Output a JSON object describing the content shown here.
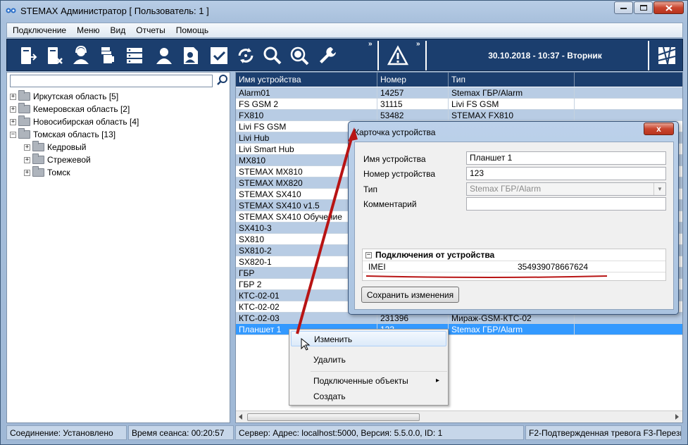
{
  "window": {
    "title": "STEMAX Администратор [ Пользователь: 1 ]"
  },
  "menu": [
    "Подключение",
    "Меню",
    "Вид",
    "Отчеты",
    "Помощь"
  ],
  "toolbar": {
    "icons": [
      "device-in-icon",
      "device-remove-icon",
      "operator-icon",
      "hand-icon",
      "server-icon",
      "user-icon",
      "user-card-icon",
      "check-icon",
      "refresh-icon",
      "search-icon",
      "zoom-in-icon",
      "wrench-icon"
    ],
    "chevron": "»",
    "datetime": "30.10.2018 - 10:37 - Вторник"
  },
  "tree": [
    {
      "label": "Иркутская область [5]",
      "level": 0
    },
    {
      "label": "Кемеровская область [2]",
      "level": 0
    },
    {
      "label": "Новосибирская область [4]",
      "level": 0
    },
    {
      "label": "Томская область [13]",
      "level": 0
    },
    {
      "label": "Кедровый",
      "level": 1
    },
    {
      "label": "Стрежевой",
      "level": 1
    },
    {
      "label": "Томск",
      "level": 1
    }
  ],
  "grid": {
    "columns": [
      "Имя устройства",
      "Номер",
      "Тип"
    ],
    "rows": [
      [
        "Alarm01",
        "14257",
        "Stemax ГБР/Alarm"
      ],
      [
        "FS GSM 2",
        "31115",
        "Livi FS GSM"
      ],
      [
        "FX810",
        "53482",
        "STEMAX FX810"
      ],
      [
        "Livi FS GSM",
        "",
        ""
      ],
      [
        "Livi Hub",
        "",
        ""
      ],
      [
        "Livi Smart Hub",
        "",
        ""
      ],
      [
        "MX810",
        "",
        ""
      ],
      [
        "STEMAX MX810",
        "",
        ""
      ],
      [
        "STEMAX MX820",
        "",
        ""
      ],
      [
        "STEMAX SX410",
        "",
        ""
      ],
      [
        "STEMAX SX410 v1.5",
        "",
        ""
      ],
      [
        "STEMAX SX410 Обучение",
        "",
        ""
      ],
      [
        "SX410-3",
        "",
        ""
      ],
      [
        "SX810",
        "",
        ""
      ],
      [
        "SX810-2",
        "",
        ""
      ],
      [
        "SX820-1",
        "",
        ""
      ],
      [
        "ГБР",
        "",
        ""
      ],
      [
        "ГБР 2",
        "",
        ""
      ],
      [
        "КТС-02-01",
        "",
        ""
      ],
      [
        "КТС-02-02",
        "",
        ""
      ],
      [
        "КТС-02-03",
        "231396",
        "Мираж-GSM-КТС-02"
      ],
      [
        "Планшет 1",
        "123",
        "Stemax ГБР/Alarm"
      ]
    ]
  },
  "status": {
    "connection": "Соединение: Установлено",
    "session": "Время сеанса: 00:20:57",
    "server": "Сервер: Адрес: localhost:5000, Версия: 5.5.0.0, ID: 1",
    "hotkeys": "F2-Подтвержденная тревога  F3-Перезв"
  },
  "dialog": {
    "title": "Карточка устройства",
    "close": "x",
    "fields": {
      "name_label": "Имя устройства",
      "name_value": "Планшет 1",
      "number_label": "Номер устройства",
      "number_value": "123",
      "type_label": "Тип",
      "type_value": "Stemax ГБР/Alarm",
      "comment_label": "Комментарий",
      "comment_value": ""
    },
    "connections": {
      "header": "Подключения от устройства",
      "key": "IMEI",
      "value": "354939078667624"
    },
    "save": "Сохранить изменения"
  },
  "context_menu": {
    "items": [
      "Изменить",
      "Удалить",
      "Подключенные объекты",
      "Создать"
    ],
    "submenu_arrow": "▸"
  },
  "colors": {
    "toolbar_bg": "#1b3e6e",
    "row_alt": "#b8cce4",
    "row_selected": "#3399ff",
    "annotation": "#b81414"
  }
}
